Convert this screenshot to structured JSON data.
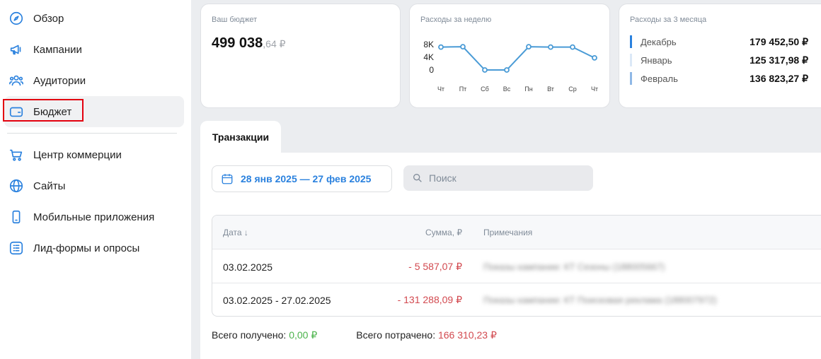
{
  "sidebar": {
    "items": [
      {
        "label": "Обзор",
        "icon": "compass-icon"
      },
      {
        "label": "Кампании",
        "icon": "megaphone-icon"
      },
      {
        "label": "Аудитории",
        "icon": "users-icon"
      },
      {
        "label": "Бюджет",
        "icon": "wallet-icon",
        "active": true
      },
      {
        "label": "Центр коммерции",
        "icon": "cart-icon"
      },
      {
        "label": "Сайты",
        "icon": "globe-icon"
      },
      {
        "label": "Мобильные приложения",
        "icon": "phone-icon"
      },
      {
        "label": "Лид-формы и опросы",
        "icon": "list-icon"
      }
    ]
  },
  "budget": {
    "title": "Ваш бюджет",
    "value_main": "499 038",
    "value_frac": ",64 ₽"
  },
  "weekly": {
    "title": "Расходы за неделю"
  },
  "chart_data": {
    "type": "line",
    "title": "Расходы за неделю",
    "categories": [
      "Чт",
      "Пт",
      "Сб",
      "Вс",
      "Пн",
      "Вт",
      "Ср",
      "Чт"
    ],
    "y_ticks": [
      "8K",
      "4K",
      "0"
    ],
    "ylim": [
      0,
      8000
    ],
    "values": [
      7200,
      7300,
      0,
      0,
      7300,
      7200,
      7200,
      3800
    ],
    "color": "#4a9bd6"
  },
  "months": {
    "title": "Расходы за 3 месяца",
    "rows": [
      {
        "name": "Декабрь",
        "value": "179 452,50 ₽",
        "color": "#2a81de"
      },
      {
        "name": "Январь",
        "value": "125 317,98 ₽",
        "color": "#dbe8f7"
      },
      {
        "name": "Февраль",
        "value": "136 823,27 ₽",
        "color": "#8fb8e6"
      }
    ]
  },
  "transactions": {
    "tab_label": "Транзакции",
    "date_range": "28 янв 2025 — 27 фев 2025",
    "search_placeholder": "Поиск",
    "columns": {
      "date": "Дата ↓",
      "amount": "Сумма, ₽",
      "notes": "Примечания"
    },
    "rows": [
      {
        "date": "03.02.2025",
        "amount": "-  5 587,07 ₽",
        "note": "Показы кампании: КТ Сезоны (188005667)"
      },
      {
        "date": "03.02.2025 - 27.02.2025",
        "amount": "-  131 288,09 ₽",
        "note": "Показы кампании: КТ Поисковая реклама (188007972)"
      }
    ],
    "total_received_label": "Всего получено:",
    "total_received_value": "0,00 ₽",
    "total_spent_label": "Всего потрачено:",
    "total_spent_value": "166 310,23 ₽"
  }
}
